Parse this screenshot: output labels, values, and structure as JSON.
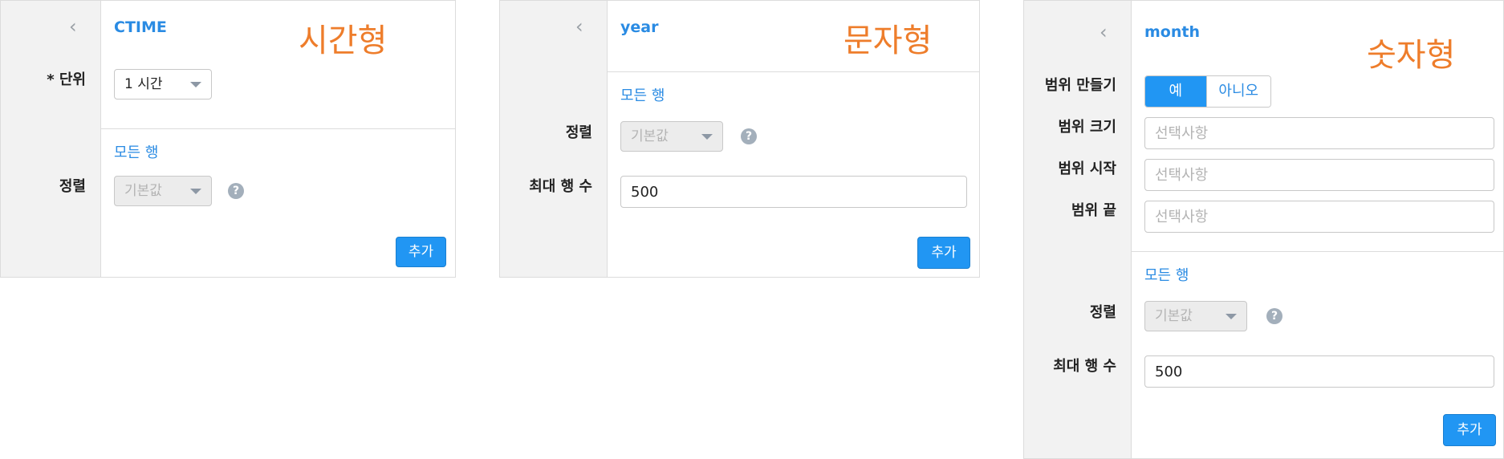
{
  "panel_time": {
    "title": "CTIME",
    "annotation": "시간형",
    "unit_label": "* 단위",
    "unit_value": "1 시간",
    "section_title": "모든 행",
    "sort_label": "정렬",
    "sort_value": "기본값",
    "help_icon": "?",
    "add_button": "추가"
  },
  "panel_string": {
    "title": "year",
    "annotation": "문자형",
    "section_title": "모든 행",
    "sort_label": "정렬",
    "sort_value": "기본값",
    "help_icon": "?",
    "max_rows_label": "최대 행 수",
    "max_rows_value": "500",
    "add_button": "추가"
  },
  "panel_number": {
    "title": "month",
    "annotation": "숫자형",
    "range_create_label": "범위 만들기",
    "range_yes": "예",
    "range_no": "아니오",
    "range_size_label": "범위 크기",
    "range_start_label": "범위 시작",
    "range_end_label": "범위 끝",
    "placeholder": "선택사항",
    "section_title": "모든 행",
    "sort_label": "정렬",
    "sort_value": "기본값",
    "help_icon": "?",
    "max_rows_label": "최대 행 수",
    "max_rows_value": "500",
    "add_button": "추가"
  },
  "icons": {
    "back": "‹"
  },
  "colors": {
    "accent": "#2196f3",
    "title": "#2a8be3",
    "annotation": "#ee7d2b"
  }
}
